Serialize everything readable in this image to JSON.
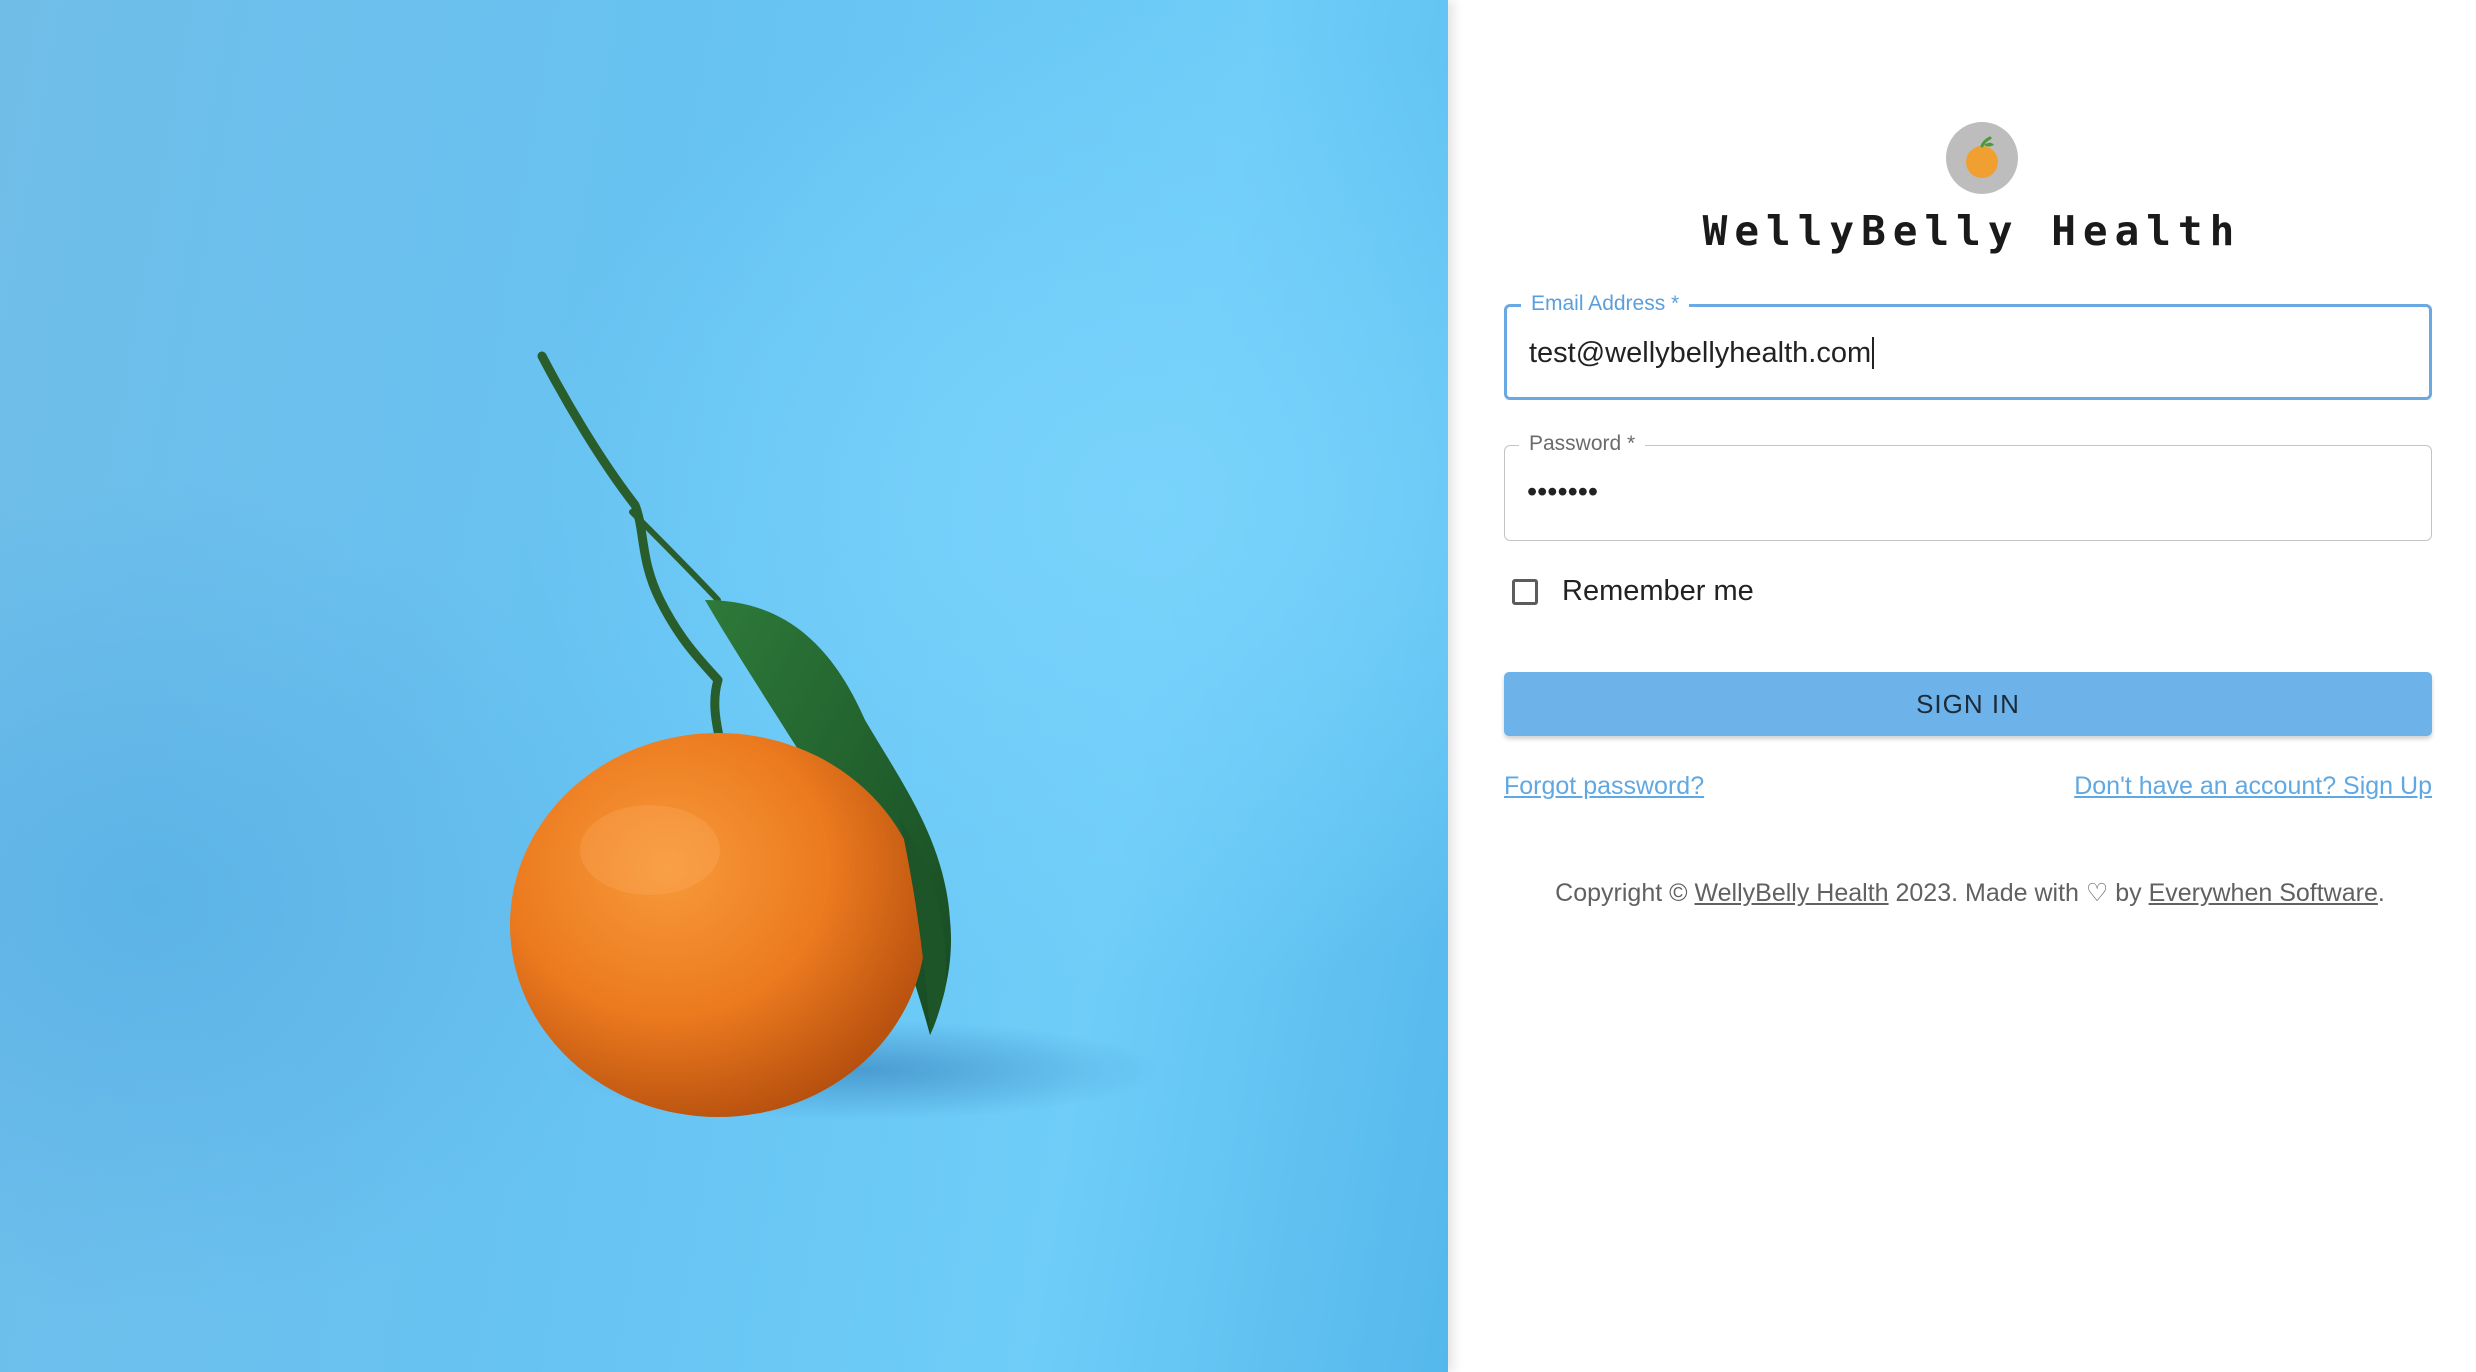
{
  "hero": {
    "image": "orange-on-blue-background-photo",
    "colors": {
      "sky": "#6cc6f4",
      "fruit": "#ec7a1f",
      "leaf": "#1f5a2b"
    }
  },
  "brand": {
    "logo_icon": "orange-fruit-icon",
    "name": "WellyBelly Health"
  },
  "form": {
    "email": {
      "label": "Email Address *",
      "value": "test@wellybellyhealth.com"
    },
    "password": {
      "label": "Password *",
      "masked_value": "•••••••"
    },
    "remember_me": {
      "label": "Remember me",
      "checked": false
    },
    "submit_label": "SIGN IN"
  },
  "links": {
    "forgot_password": "Forgot password?",
    "sign_up": "Don't have an account? Sign Up"
  },
  "footer": {
    "prefix": "Copyright © ",
    "company_link": "WellyBelly Health",
    "middle": " 2023. Made with ♡ by ",
    "vendor_link": "Everywhen Software",
    "suffix": "."
  },
  "colors": {
    "accent": "#6db3ea",
    "focused_border": "#6aa9e3",
    "link": "#5fa8e3",
    "text": "#222222"
  }
}
